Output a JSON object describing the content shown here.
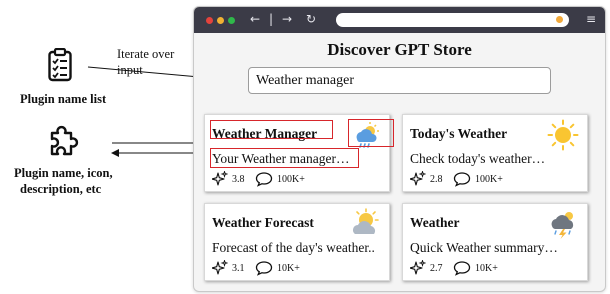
{
  "annotations": {
    "plugin_list_label": "Plugin name list",
    "plugin_info_label_line1": "Plugin name, icon,",
    "plugin_info_label_line2": "description, etc",
    "iterate_line1": "Iterate over",
    "iterate_line2": "input",
    "list_icon": "clipboard-list-icon",
    "info_icon": "puzzle-piece-icon"
  },
  "browser": {
    "title": "Discover GPT Store",
    "search_value": "Weather manager",
    "traffic_light_colors": [
      "#e4433c",
      "#f1b233",
      "#2fb84a"
    ]
  },
  "cards": [
    {
      "name": "Weather Manager",
      "description": "Your Weather manager…",
      "rating": "3.8",
      "count": "100K+",
      "icon": "cloud-rain-sun-icon"
    },
    {
      "name": "Today's Weather",
      "description": "Check today's weather…",
      "rating": "2.8",
      "count": "100K+",
      "icon": "sun-icon"
    },
    {
      "name": "Weather Forecast",
      "description": "Forecast of the day's weather..",
      "rating": "3.1",
      "count": "10K+",
      "icon": "sun-cloud-icon"
    },
    {
      "name": "Weather",
      "description": "Quick Weather summary…",
      "rating": "2.7",
      "count": "10K+",
      "icon": "thunderstorm-icon"
    }
  ],
  "colors": {
    "highlight": "#d7262b",
    "titlebar": "#3b3b47"
  }
}
